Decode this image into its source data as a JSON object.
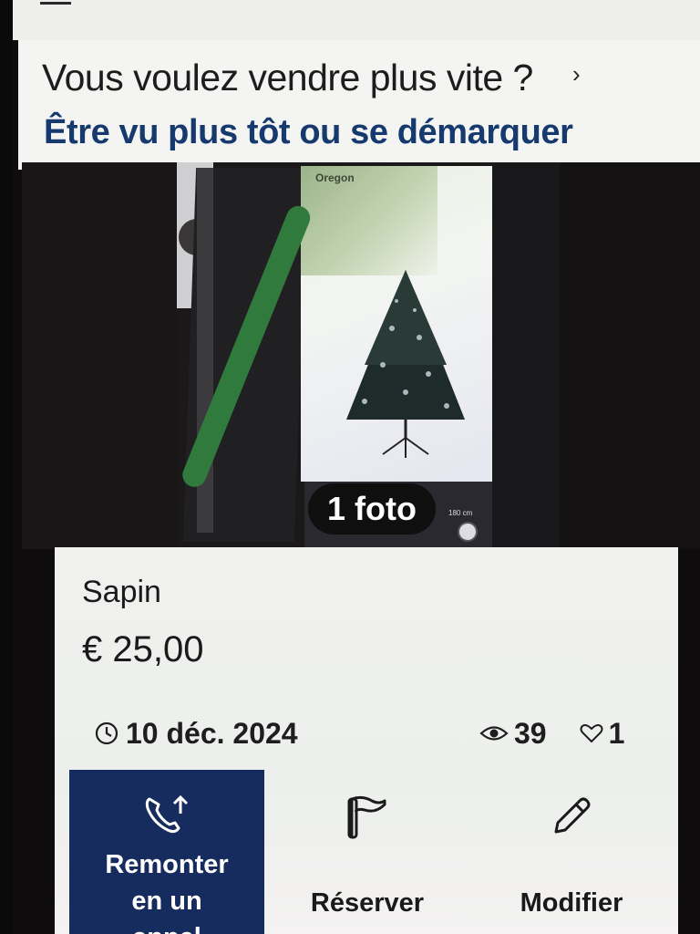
{
  "promo": {
    "title": "Vous voulez vendre plus vite ?",
    "chevron": "›",
    "subtitle": "Être vu plus tôt ou se démarquer"
  },
  "photo": {
    "count_label": "1 foto",
    "box_brand": "Oregon",
    "size_label": "180 cm"
  },
  "listing": {
    "title": "Sapin",
    "price": "€ 25,00",
    "date": "10 déc. 2024",
    "views": "39",
    "favorites": "1"
  },
  "actions": {
    "bump_label_line1": "Remonter",
    "bump_label_line2": "en un",
    "bump_label_line3": "appel",
    "reserve_label": "Réserver",
    "edit_label": "Modifier"
  },
  "icons": {
    "menu": "menu-icon",
    "chevron": "chevron-right-icon",
    "clock": "clock-icon",
    "views": "eye-icon",
    "favorites": "heart-icon",
    "bump": "phone-up-icon",
    "reserve": "flag-icon",
    "edit": "pencil-icon"
  },
  "colors": {
    "brand_navy": "#172c5e",
    "subtitle_blue": "#163a6e"
  }
}
